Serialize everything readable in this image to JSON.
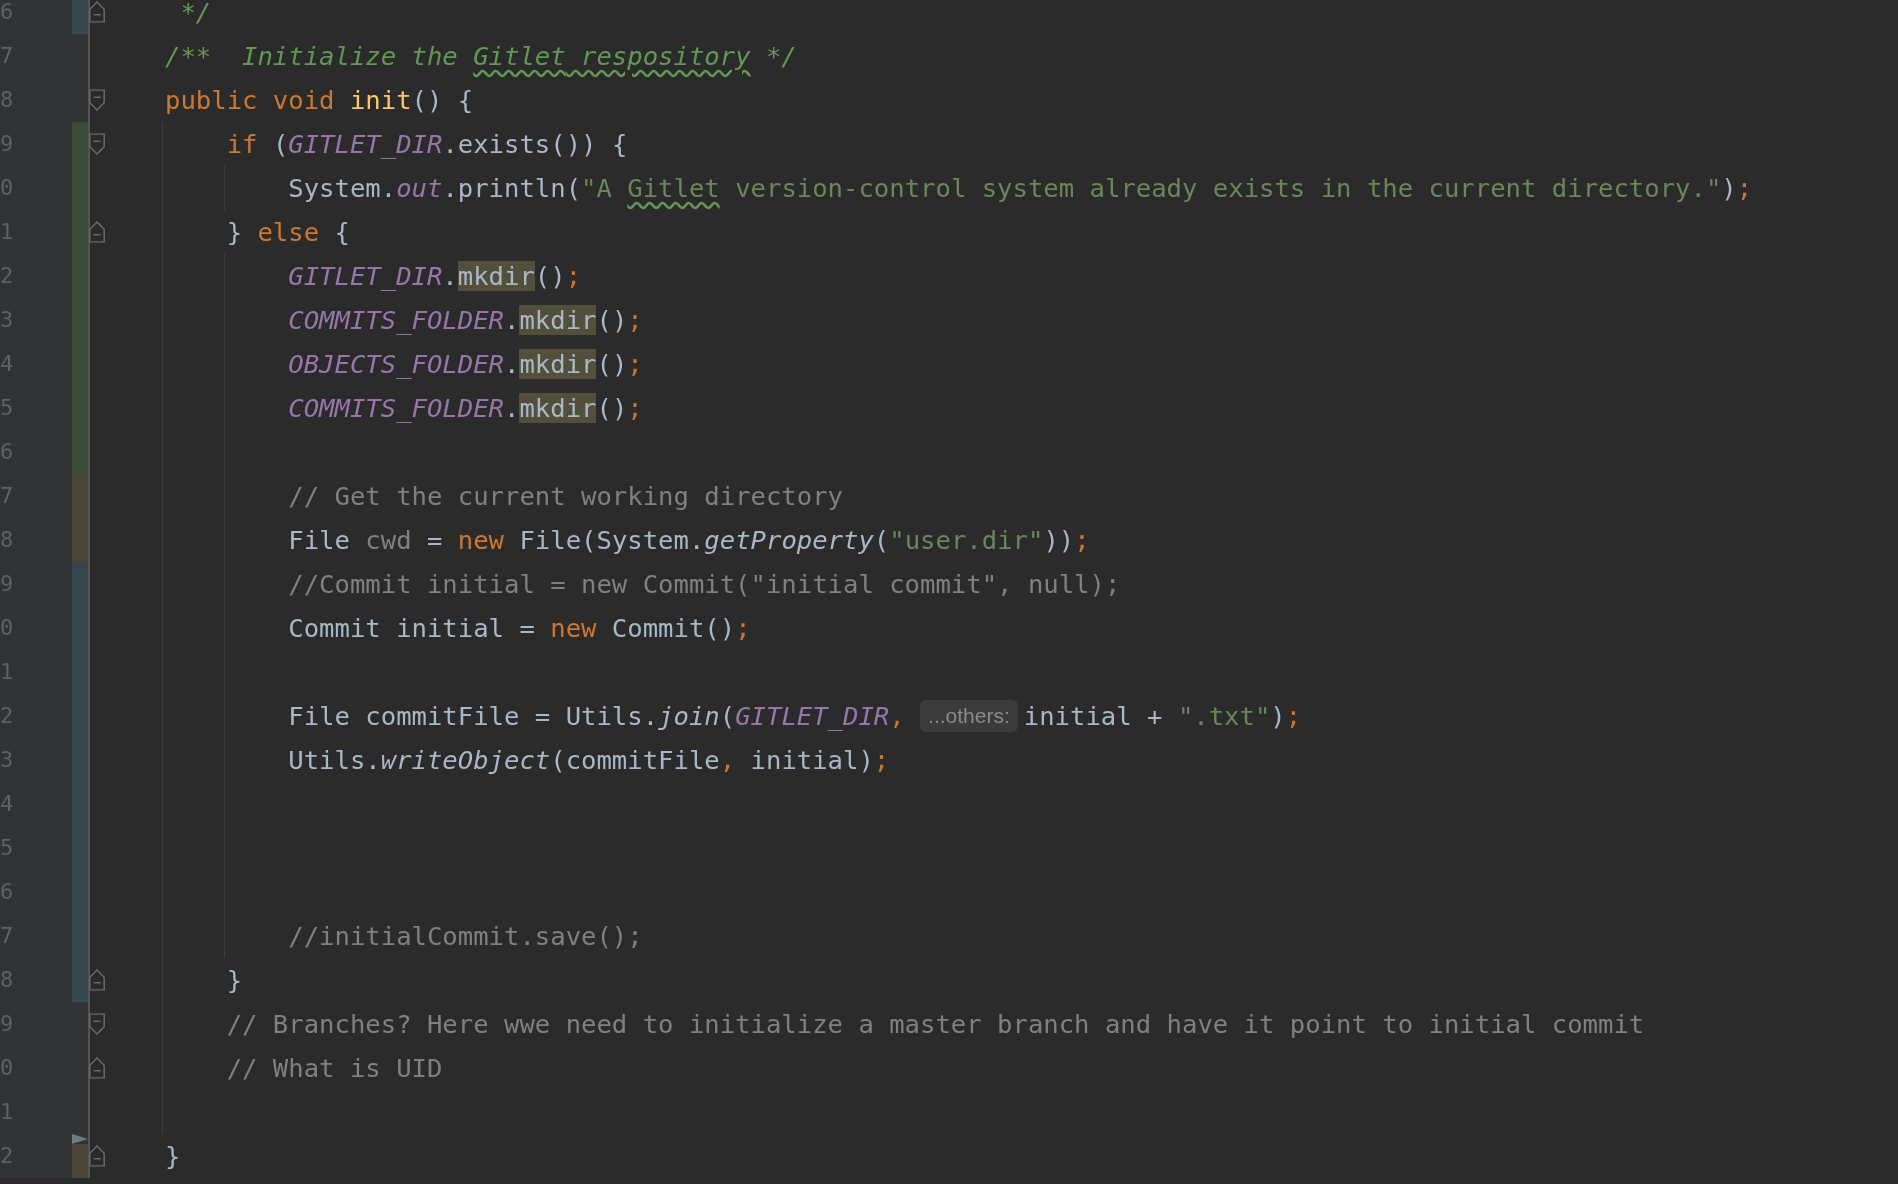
{
  "editor": {
    "lines": [
      {
        "number": "6",
        "color": "#35464f",
        "fold_end": true,
        "tokens": [
          {
            "text": " */",
            "kind": "doc"
          }
        ]
      },
      {
        "number": "7",
        "tokens": [
          {
            "text": "/**  Initialize the ",
            "kind": "doc"
          },
          {
            "text": "Gitlet",
            "kind": "doc-typo"
          },
          {
            "text": " respository",
            "kind": "doc-typo"
          },
          {
            "text": " */",
            "kind": "doc"
          }
        ]
      },
      {
        "number": "8",
        "fold_start": true,
        "tokens": [
          {
            "text": "public void ",
            "kind": "keyword"
          },
          {
            "text": "init",
            "kind": "method"
          },
          {
            "text": "() {",
            "kind": "plain"
          }
        ]
      },
      {
        "number": "9",
        "color": "#384c38",
        "fold_start": true,
        "tokens": [
          {
            "text": "    if ",
            "kind": "keyword"
          },
          {
            "text": "(",
            "kind": "plain"
          },
          {
            "text": "GITLET_DIR",
            "kind": "constant"
          },
          {
            "text": ".exists()) {",
            "kind": "plain"
          }
        ]
      },
      {
        "number": "0",
        "color": "#384c38",
        "tokens": [
          {
            "text": "        System.",
            "kind": "plain"
          },
          {
            "text": "out",
            "kind": "constant"
          },
          {
            "text": ".println(",
            "kind": "plain"
          },
          {
            "text": "\"A ",
            "kind": "string"
          },
          {
            "text": "Gitlet",
            "kind": "string-typo"
          },
          {
            "text": " version-control system already exists in the current directory.\"",
            "kind": "string"
          },
          {
            "text": ")",
            "kind": "plain"
          },
          {
            "text": ";",
            "kind": "keyword"
          }
        ]
      },
      {
        "number": "1",
        "color": "#384c38",
        "fold_end": true,
        "tokens": [
          {
            "text": "    } ",
            "kind": "plain"
          },
          {
            "text": "else",
            "kind": "keyword"
          },
          {
            "text": " {",
            "kind": "plain"
          }
        ]
      },
      {
        "number": "2",
        "color": "#384c38",
        "tokens": [
          {
            "text": "        GITLET_DIR",
            "kind": "constant"
          },
          {
            "text": ".",
            "kind": "plain"
          },
          {
            "text": "mkdir",
            "kind": "highlight"
          },
          {
            "text": "()",
            "kind": "plain"
          },
          {
            "text": ";",
            "kind": "keyword"
          }
        ]
      },
      {
        "number": "3",
        "color": "#384c38",
        "tokens": [
          {
            "text": "        COMMITS_FOLDER",
            "kind": "constant"
          },
          {
            "text": ".",
            "kind": "plain"
          },
          {
            "text": "mkdir",
            "kind": "highlight"
          },
          {
            "text": "()",
            "kind": "plain"
          },
          {
            "text": ";",
            "kind": "keyword"
          }
        ]
      },
      {
        "number": "4",
        "color": "#384c38",
        "tokens": [
          {
            "text": "        OBJECTS_FOLDER",
            "kind": "constant"
          },
          {
            "text": ".",
            "kind": "plain"
          },
          {
            "text": "mkdir",
            "kind": "highlight"
          },
          {
            "text": "()",
            "kind": "plain"
          },
          {
            "text": ";",
            "kind": "keyword"
          }
        ]
      },
      {
        "number": "5",
        "color": "#384c38",
        "tokens": [
          {
            "text": "        COMMITS_FOLDER",
            "kind": "constant"
          },
          {
            "text": ".",
            "kind": "plain"
          },
          {
            "text": "mkdir",
            "kind": "highlight"
          },
          {
            "text": "()",
            "kind": "plain"
          },
          {
            "text": ";",
            "kind": "keyword"
          }
        ]
      },
      {
        "number": "6",
        "color": "#384c38"
      },
      {
        "number": "7",
        "color": "#4a4536",
        "tokens": [
          {
            "text": "        // Get the current working directory",
            "kind": "comment"
          }
        ]
      },
      {
        "number": "8",
        "color": "#4a4536",
        "tokens": [
          {
            "text": "        File ",
            "kind": "plain"
          },
          {
            "text": "cwd",
            "kind": "unused"
          },
          {
            "text": " = ",
            "kind": "plain"
          },
          {
            "text": "new",
            "kind": "keyword"
          },
          {
            "text": " File(System.",
            "kind": "plain"
          },
          {
            "text": "getProperty",
            "kind": "static-call"
          },
          {
            "text": "(",
            "kind": "plain"
          },
          {
            "text": "\"user.dir\"",
            "kind": "string"
          },
          {
            "text": "))",
            "kind": "plain"
          },
          {
            "text": ";",
            "kind": "keyword"
          }
        ]
      },
      {
        "number": "9",
        "color": "#35464f",
        "tokens": [
          {
            "text": "        //Commit initial = new Commit(\"initial commit\", null);",
            "kind": "comment"
          }
        ]
      },
      {
        "number": "0",
        "color": "#35464f",
        "tokens": [
          {
            "text": "        Commit initial = ",
            "kind": "plain"
          },
          {
            "text": "new",
            "kind": "keyword"
          },
          {
            "text": " Commit()",
            "kind": "plain"
          },
          {
            "text": ";",
            "kind": "keyword"
          }
        ]
      },
      {
        "number": "1",
        "color": "#35464f"
      },
      {
        "number": "2",
        "color": "#35464f",
        "tokens": [
          {
            "text": "        File commitFile = Utils.",
            "kind": "plain"
          },
          {
            "text": "join",
            "kind": "static-call"
          },
          {
            "text": "(",
            "kind": "plain"
          },
          {
            "text": "GITLET_DIR",
            "kind": "constant"
          },
          {
            "text": ", ",
            "kind": "keyword"
          },
          {
            "text": "...others:",
            "kind": "hint"
          },
          {
            "text": "initial + ",
            "kind": "plain"
          },
          {
            "text": "\".txt\"",
            "kind": "string"
          },
          {
            "text": ")",
            "kind": "plain"
          },
          {
            "text": ";",
            "kind": "keyword"
          }
        ]
      },
      {
        "number": "3",
        "color": "#35464f",
        "tokens": [
          {
            "text": "        Utils.",
            "kind": "plain"
          },
          {
            "text": "writeObject",
            "kind": "static-call"
          },
          {
            "text": "(commitFile",
            "kind": "plain"
          },
          {
            "text": ",",
            "kind": "keyword"
          },
          {
            "text": " initial)",
            "kind": "plain"
          },
          {
            "text": ";",
            "kind": "keyword"
          }
        ]
      },
      {
        "number": "4",
        "color": "#35464f"
      },
      {
        "number": "5",
        "color": "#35464f"
      },
      {
        "number": "6",
        "color": "#35464f"
      },
      {
        "number": "7",
        "color": "#35464f",
        "tokens": [
          {
            "text": "        //initialCommit.save();",
            "kind": "comment"
          }
        ]
      },
      {
        "number": "8",
        "color": "#35464f",
        "fold_end": true,
        "tokens": [
          {
            "text": "    }",
            "kind": "plain"
          }
        ]
      },
      {
        "number": "9",
        "fold_start": true,
        "tokens": [
          {
            "text": "    // Branches? Here wwe need to initialize a master branch and have it point to initial commit",
            "kind": "comment"
          }
        ]
      },
      {
        "number": "0",
        "fold_end": true,
        "tokens": [
          {
            "text": "    // What is UID",
            "kind": "comment"
          }
        ]
      },
      {
        "number": "1"
      },
      {
        "number": "2",
        "color": "#4a4536",
        "fold_end": true,
        "deleted": true,
        "tokens": [
          {
            "text": "}",
            "kind": "plain"
          }
        ]
      }
    ]
  }
}
